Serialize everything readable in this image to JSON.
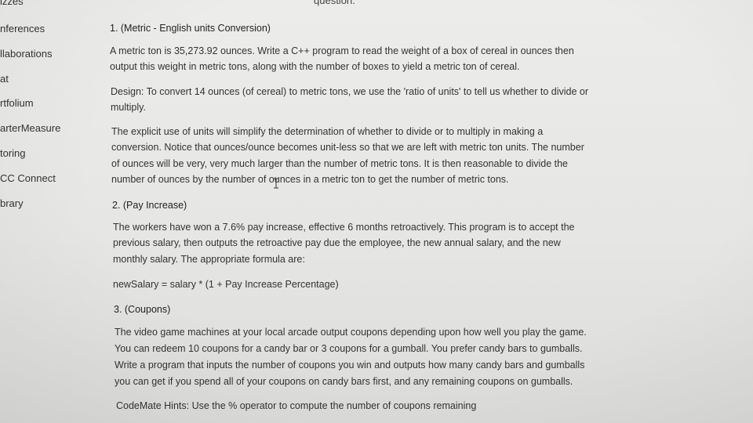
{
  "header": {
    "top_title": "question."
  },
  "sidebar": {
    "items": [
      {
        "label": "izzes"
      },
      {
        "label": "nferences"
      },
      {
        "label": "llaborations"
      },
      {
        "label": "at"
      },
      {
        "label": "rtfolium"
      },
      {
        "label": "arterMeasure"
      },
      {
        "label": "toring"
      },
      {
        "label": "CC Connect"
      },
      {
        "label": "brary"
      }
    ]
  },
  "questions": {
    "q1": {
      "heading": "1. (Metric - English units Conversion)",
      "p1": [
        "A metric ton is 35,273.92 ounces. Write a C++ program to read the weight of a box of cereal in ounces then",
        "output this weight in metric tons, along with the number of boxes to yield a metric ton of cereal."
      ],
      "p2": [
        "Design: To convert 14 ounces (of cereal) to metric tons, we use the 'ratio of units' to tell us whether to divide or",
        "multiply."
      ],
      "p3": [
        "The explicit use of units will simplify the determination of whether to divide or to multiply in making a",
        "conversion. Notice that ounces/ounce becomes unit-less so that we are left with metric ton units. The number",
        "of ounces will be very, very much larger than the number of metric tons. It is then reasonable to divide the",
        "number of ounces by the number of ounces in a metric ton to get the number of metric tons."
      ]
    },
    "q2": {
      "heading": "2. (Pay Increase)",
      "p1": [
        "The workers have won a 7.6% pay increase, effective 6 months retroactively. This program is to accept the",
        "previous salary, then outputs the retroactive pay due the employee, the new annual salary, and the new",
        "monthly salary.  The appropriate formula are:"
      ],
      "formula": "newSalary = salary * (1 + Pay Increase Percentage)"
    },
    "q3": {
      "heading": "3. (Coupons)",
      "p1": [
        "The video game machines at your local arcade output coupons depending upon how well you play the game.",
        "You can redeem 10 coupons for a candy bar or 3 coupons for a gumball.  You prefer candy bars to gumballs.",
        "Write a program that inputs the number of coupons you win and outputs how many candy bars and gumballs",
        "you can get if you spend all of your coupons on candy bars first, and any remaining coupons on gumballs."
      ],
      "hint": "CodeMate Hints:  Use the % operator to compute the number of coupons remaining"
    }
  }
}
